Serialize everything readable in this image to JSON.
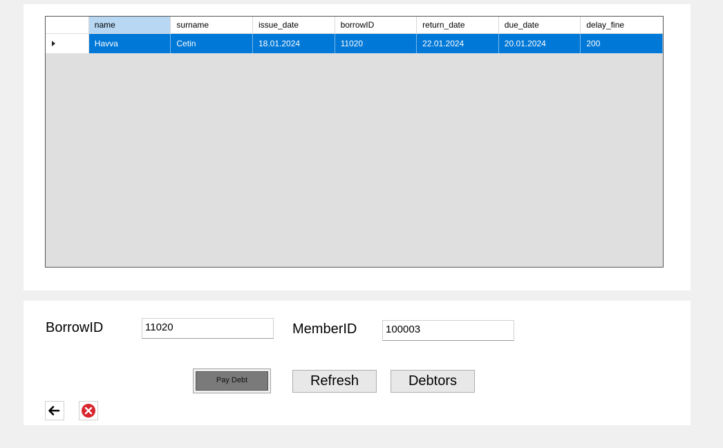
{
  "grid": {
    "columns": [
      "name",
      "surname",
      "issue_date",
      "borrowID",
      "return_date",
      "due_date",
      "delay_fine"
    ],
    "rows": [
      [
        "Havva",
        "Cetin",
        "18.01.2024",
        "11020",
        "22.01.2024",
        "20.01.2024",
        "200"
      ]
    ]
  },
  "form": {
    "borrow_label": "BorrowID",
    "borrow_value": "11020",
    "member_label": "MemberID",
    "member_value": "100003"
  },
  "buttons": {
    "pay": "Pay Debt",
    "refresh": "Refresh",
    "debtors": "Debtors"
  },
  "icons": {
    "back": "arrow-left-icon",
    "close": "close-icon"
  },
  "colors": {
    "selection": "#0078d7",
    "selected_header": "#b7d7f3",
    "close_red": "#d8262f"
  }
}
